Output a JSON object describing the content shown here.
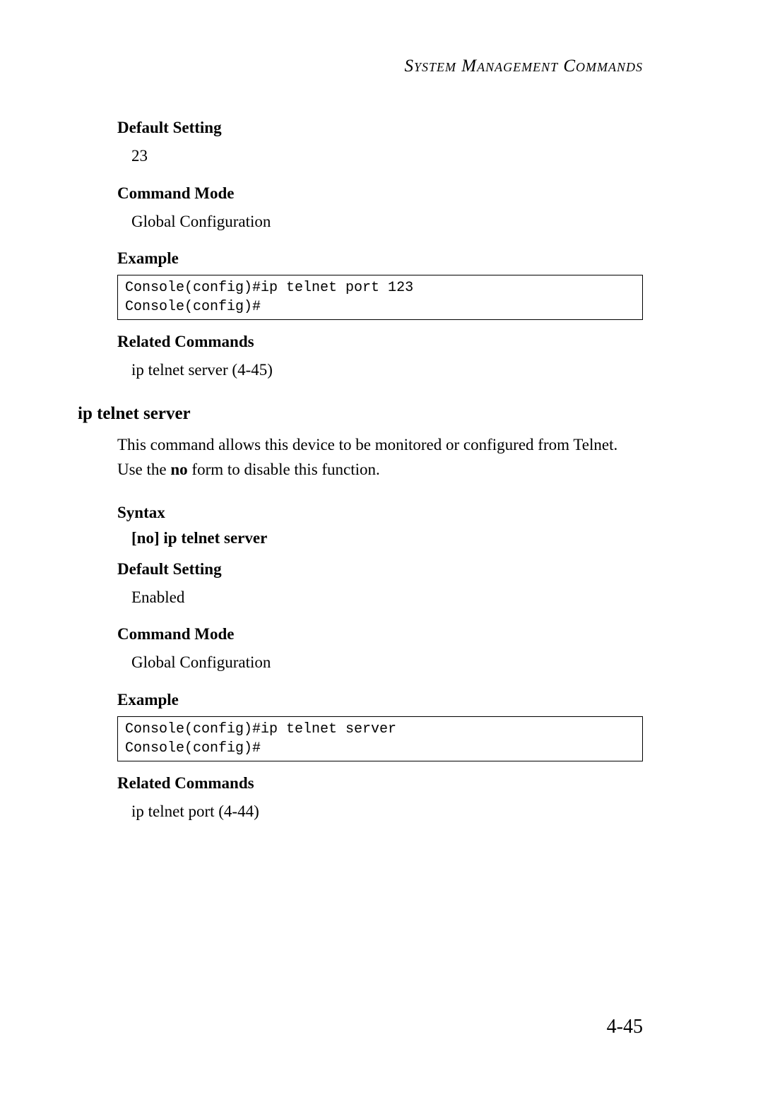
{
  "header": "System Management Commands",
  "sec1": {
    "default_setting_h": "Default Setting",
    "default_setting_v": "23",
    "command_mode_h": "Command Mode",
    "command_mode_v": "Global Configuration",
    "example_h": "Example",
    "example_code": "Console(config)#ip telnet port 123\nConsole(config)#",
    "related_h": "Related Commands",
    "related_v": "ip telnet server (4-45)"
  },
  "cmd": {
    "title": "ip telnet server",
    "desc_pre": "This command allows this device to be monitored or configured from Telnet. Use the ",
    "desc_bold": "no",
    "desc_post": " form to disable this function.",
    "syntax_h": "Syntax",
    "syntax_bracket_open": "[",
    "syntax_no": "no",
    "syntax_bracket_close": "]",
    "syntax_cmd": " ip telnet server",
    "default_setting_h": "Default Setting",
    "default_setting_v": "Enabled",
    "command_mode_h": "Command Mode",
    "command_mode_v": "Global Configuration",
    "example_h": "Example",
    "example_code": "Console(config)#ip telnet server\nConsole(config)#",
    "related_h": "Related Commands",
    "related_v": "ip telnet port (4-44)"
  },
  "page_number": "4-45"
}
